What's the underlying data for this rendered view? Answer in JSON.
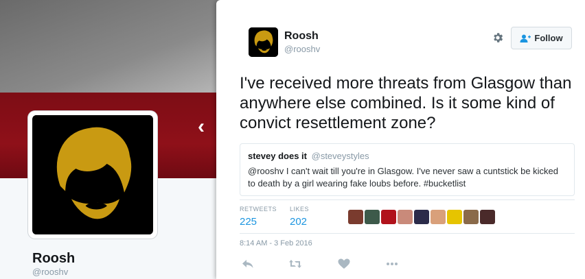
{
  "profile": {
    "name": "Roosh",
    "handle": "@rooshv",
    "colors": {
      "header_red": "#8f1019",
      "avatar_bg": "#000000",
      "avatar_fill": "#c99a12"
    }
  },
  "nav": {
    "prev_icon": "chevron-left-icon",
    "prev_glyph": "‹"
  },
  "tweet": {
    "author_name": "Roosh",
    "author_handle": "@rooshv",
    "follow_label": "Follow",
    "text": "I've received more threats from Glasgow than anywhere else combined. Is it some kind of convict resettlement zone?",
    "quote": {
      "name": "stevey does it",
      "handle": "@steveystyles",
      "text": "@rooshv I can't wait till you're in Glasgow. I've never saw a cuntstick be kicked to death by a girl wearing fake loubs before. #bucketlist"
    },
    "retweets_label": "RETWEETS",
    "retweets": "225",
    "likes_label": "LIKES",
    "likes": "202",
    "likers": [
      {
        "name": "liker-1",
        "color": "#7a3b2e"
      },
      {
        "name": "liker-2",
        "color": "#3d5a4a"
      },
      {
        "name": "liker-3",
        "color": "#b1121b"
      },
      {
        "name": "liker-4",
        "color": "#c98a7a"
      },
      {
        "name": "liker-5",
        "color": "#2b2b4a"
      },
      {
        "name": "liker-6",
        "color": "#d9a07a"
      },
      {
        "name": "liker-7",
        "color": "#e6c400"
      },
      {
        "name": "liker-8",
        "color": "#8a6a4a"
      },
      {
        "name": "liker-9",
        "color": "#4a2a2a"
      }
    ],
    "timestamp": "8:14 AM - 3 Feb 2016",
    "actions": [
      "reply-icon",
      "retweet-icon",
      "like-icon",
      "more-icon"
    ],
    "accent_color": "#1b95e0"
  }
}
